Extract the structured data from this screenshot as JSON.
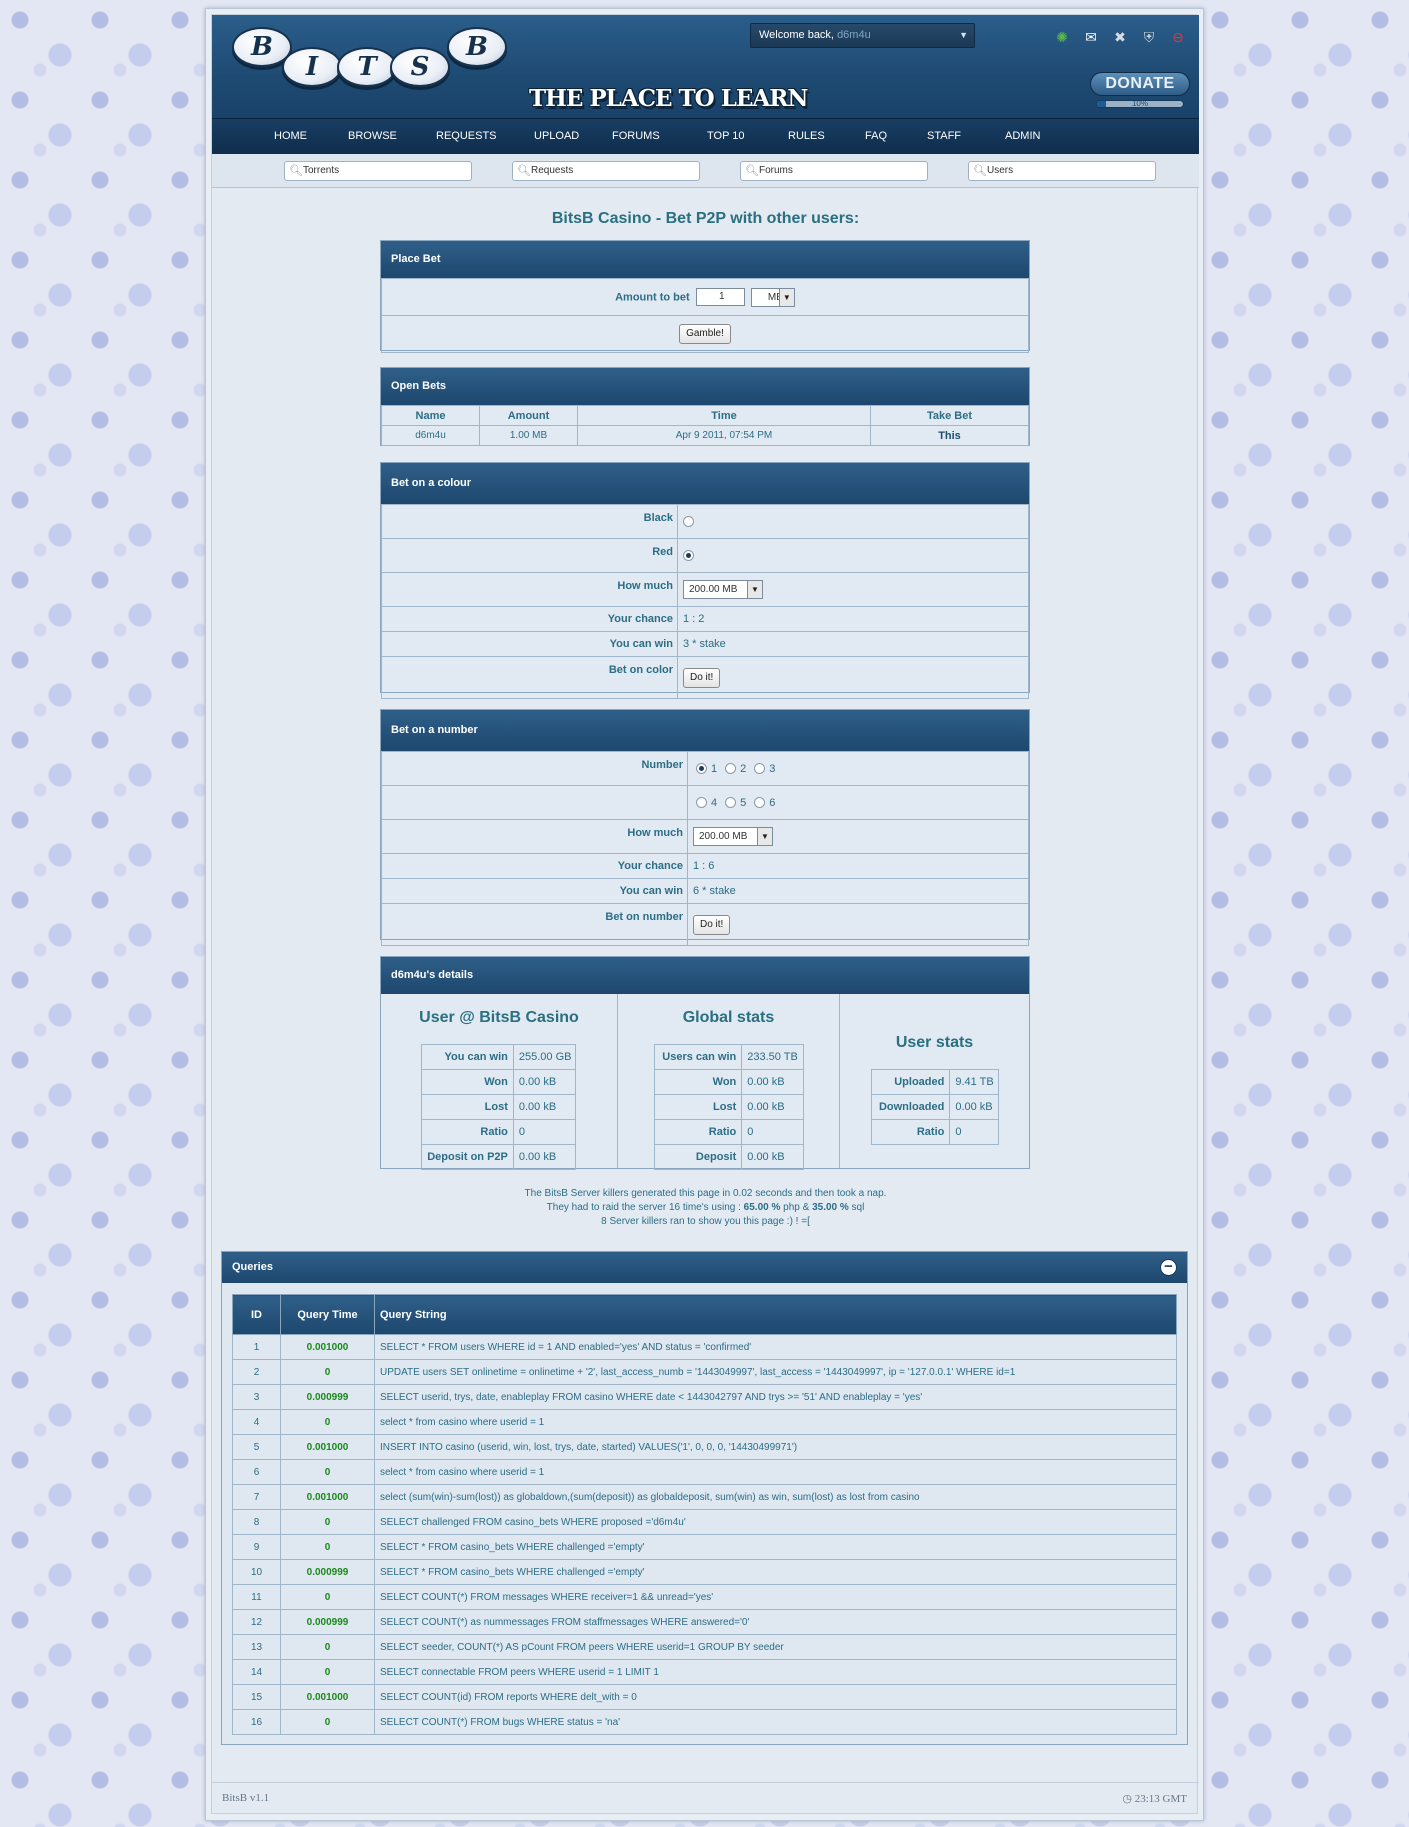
{
  "header": {
    "logo_letters": [
      "B",
      "I",
      "T",
      "S",
      "B"
    ],
    "tagline": "THE PLACE TO LEARN",
    "welcome_prefix": "Welcome back, ",
    "username": "d6m4u",
    "donate_label": "DONATE",
    "donate_progress_text": "10%",
    "donate_progress": 0.1,
    "icons": [
      {
        "name": "bug-icon",
        "glyph": "✺",
        "color": "#5ab84a"
      },
      {
        "name": "mail-icon",
        "glyph": "✉",
        "color": "#ffffff"
      },
      {
        "name": "tools-icon",
        "glyph": "✖",
        "color": "#d8dde3"
      },
      {
        "name": "shield-icon",
        "glyph": "⛨",
        "color": "#c9d2db"
      },
      {
        "name": "logout-icon",
        "glyph": "⊖",
        "color": "#e33"
      }
    ]
  },
  "nav": [
    "HOME",
    "BROWSE",
    "REQUESTS",
    "UPLOAD",
    "FORUMS",
    "TOP 10",
    "RULES",
    "FAQ",
    "STAFF",
    "ADMIN"
  ],
  "search": [
    "Torrents",
    "Requests",
    "Forums",
    "Users"
  ],
  "title": "BitsB Casino - Bet P2P with other users:",
  "place_bet": {
    "header": "Place Bet",
    "amount_label": "Amount to bet",
    "amount_value": "1",
    "unit": "MB",
    "button": "Gamble!"
  },
  "open_bets": {
    "header": "Open Bets",
    "columns": [
      "Name",
      "Amount",
      "Time",
      "Take Bet"
    ],
    "rows": [
      [
        "d6m4u",
        "1.00 MB",
        "Apr 9 2011, 07:54 PM",
        "This"
      ]
    ]
  },
  "colour": {
    "header": "Bet on a colour",
    "black": "Black",
    "red": "Red",
    "how_much": "How much",
    "amount": "200.00 MB",
    "chance_label": "Your chance",
    "chance": "1 : 2",
    "win_label": "You can win",
    "win": "3 * stake",
    "bet_label": "Bet on color",
    "button": "Do it!",
    "selected": "red"
  },
  "number": {
    "header": "Bet on a number",
    "label": "Number",
    "row1": [
      "1",
      "2",
      "3"
    ],
    "row2": [
      "4",
      "5",
      "6"
    ],
    "selected": "1",
    "how_much": "How much",
    "amount": "200.00 MB",
    "chance_label": "Your chance",
    "chance": "1 : 6",
    "win_label": "You can win",
    "win": "6 * stake",
    "bet_label": "Bet on number",
    "button": "Do it!"
  },
  "details": {
    "header": "d6m4u's details",
    "user": {
      "title": "User @ BitsB Casino",
      "rows": [
        [
          "You can win",
          "255.00 GB"
        ],
        [
          "Won",
          "0.00 kB"
        ],
        [
          "Lost",
          "0.00 kB"
        ],
        [
          "Ratio",
          "0"
        ],
        [
          "Deposit on P2P",
          "0.00 kB"
        ]
      ]
    },
    "global": {
      "title": "Global stats",
      "rows": [
        [
          "Users can win",
          "233.50 TB"
        ],
        [
          "Won",
          "0.00 kB"
        ],
        [
          "Lost",
          "0.00 kB"
        ],
        [
          "Ratio",
          "0"
        ],
        [
          "Deposit",
          "0.00 kB"
        ]
      ]
    },
    "stats": {
      "title": "User stats",
      "rows": [
        [
          "Uploaded",
          "9.41 TB"
        ],
        [
          "Downloaded",
          "0.00 kB"
        ],
        [
          "Ratio",
          "0"
        ]
      ]
    }
  },
  "footnote": {
    "line1": "The BitsB Server killers generated this page in 0.02 seconds and then took a nap.",
    "line2_a": "They had to raid the server 16 time's using : ",
    "php": "65.00 %",
    "line2_b": " php & ",
    "sql": "35.00 %",
    "line2_c": " sql",
    "line3": "8 Server killers ran to show you this page :) ! =["
  },
  "queries": {
    "header": "Queries",
    "columns": [
      "ID",
      "Query Time",
      "Query String"
    ],
    "rows": [
      [
        "1",
        "0.001000",
        "SELECT * FROM users WHERE id = 1 AND enabled='yes' AND status = 'confirmed'"
      ],
      [
        "2",
        "0",
        "UPDATE users SET onlinetime = onlinetime + '2', last_access_numb = '1443049997', last_access = '1443049997', ip = '127.0.0.1' WHERE id=1"
      ],
      [
        "3",
        "0.000999",
        "SELECT userid, trys, date, enableplay FROM casino WHERE date < 1443042797 AND trys >= '51' AND enableplay = 'yes'"
      ],
      [
        "4",
        "0",
        "select * from casino where userid = 1"
      ],
      [
        "5",
        "0.001000",
        "INSERT INTO casino (userid, win, lost, trys, date, started) VALUES('1', 0, 0, 0, '14430499971')"
      ],
      [
        "6",
        "0",
        "select * from casino where userid = 1"
      ],
      [
        "7",
        "0.001000",
        "select (sum(win)-sum(lost)) as globaldown,(sum(deposit)) as globaldeposit, sum(win) as win, sum(lost) as lost from casino"
      ],
      [
        "8",
        "0",
        "SELECT challenged FROM casino_bets WHERE proposed ='d6m4u'"
      ],
      [
        "9",
        "0",
        "SELECT * FROM casino_bets WHERE challenged ='empty'"
      ],
      [
        "10",
        "0.000999",
        "SELECT * FROM casino_bets WHERE challenged ='empty'"
      ],
      [
        "11",
        "0",
        "SELECT COUNT(*) FROM messages WHERE receiver=1 && unread='yes'"
      ],
      [
        "12",
        "0.000999",
        "SELECT COUNT(*) as nummessages FROM staffmessages WHERE answered='0'"
      ],
      [
        "13",
        "0",
        "SELECT seeder, COUNT(*) AS pCount FROM peers WHERE userid=1 GROUP BY seeder"
      ],
      [
        "14",
        "0",
        "SELECT connectable FROM peers WHERE userid = 1 LIMIT 1"
      ],
      [
        "15",
        "0.001000",
        "SELECT COUNT(id) FROM reports WHERE delt_with = 0"
      ],
      [
        "16",
        "0",
        "SELECT COUNT(*) FROM bugs WHERE status = 'na'"
      ]
    ]
  },
  "footer": {
    "version": "BitsB v1.1",
    "time": "23:13 GMT"
  }
}
